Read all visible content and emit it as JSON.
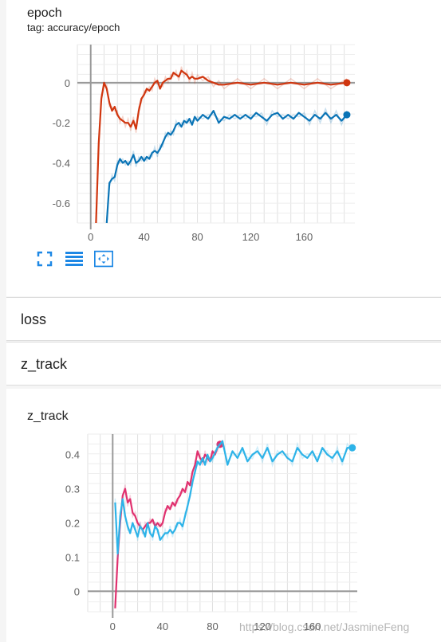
{
  "epoch_card": {
    "title": "epoch",
    "tag": "tag: accuracy/epoch",
    "tools": [
      "fit-domain-icon",
      "toggle-log-icon",
      "fit-to-data-icon"
    ]
  },
  "sections": {
    "loss": "loss",
    "z_track": "z_track"
  },
  "z_card": {
    "title": "z_track"
  },
  "watermark": "https://blog.csdn.net/JasmineFeng",
  "colors": {
    "red": "#d0360f",
    "red_light": "#f7b3a3",
    "blue": "#0a74b6",
    "blue_light": "#a9dcf2",
    "pink": "#e0316f",
    "cyan": "#2db3e8"
  },
  "chart_data": [
    {
      "type": "line",
      "title": "epoch",
      "subtitle": "tag: accuracy/epoch",
      "x_ticks": [
        0,
        40,
        80,
        120,
        160
      ],
      "y_ticks": [
        "0",
        "-0.2",
        "-0.4",
        "-0.6"
      ],
      "xlim": [
        -10,
        198
      ],
      "ylim": [
        -0.7,
        0.19
      ],
      "series": [
        {
          "color": "#d0360f",
          "x": [
            4,
            6,
            8,
            10,
            12,
            14,
            16,
            18,
            20,
            22,
            24,
            26,
            28,
            30,
            32,
            34,
            36,
            38,
            40,
            42,
            44,
            46,
            48,
            50,
            52,
            54,
            56,
            58,
            60,
            62,
            64,
            66,
            68,
            70,
            72,
            74,
            76,
            78,
            80,
            84,
            88,
            92,
            96,
            100,
            110,
            120,
            130,
            140,
            150,
            160,
            170,
            180,
            192
          ],
          "y": [
            -0.7,
            -0.3,
            -0.08,
            0.0,
            -0.03,
            -0.1,
            -0.14,
            -0.12,
            -0.16,
            -0.18,
            -0.19,
            -0.2,
            -0.2,
            -0.22,
            -0.19,
            -0.23,
            -0.14,
            -0.08,
            -0.06,
            -0.03,
            -0.04,
            -0.02,
            0.0,
            0.01,
            -0.03,
            0.0,
            0.01,
            0.02,
            0.02,
            0.05,
            0.04,
            0.03,
            0.06,
            0.05,
            0.04,
            0.02,
            0.03,
            0.02,
            0.02,
            0.03,
            0.01,
            0.0,
            -0.01,
            -0.01,
            0.0,
            -0.01,
            0.0,
            -0.01,
            0.0,
            -0.01,
            0.0,
            -0.01,
            0.0
          ]
        },
        {
          "color": "#0a74b6",
          "x": [
            12,
            14,
            16,
            18,
            20,
            22,
            24,
            26,
            28,
            30,
            32,
            34,
            36,
            38,
            40,
            42,
            44,
            46,
            48,
            50,
            52,
            54,
            56,
            58,
            60,
            62,
            64,
            66,
            68,
            70,
            72,
            74,
            76,
            78,
            80,
            84,
            88,
            92,
            96,
            100,
            104,
            108,
            112,
            116,
            120,
            124,
            128,
            132,
            136,
            140,
            144,
            148,
            152,
            156,
            160,
            164,
            168,
            172,
            176,
            180,
            184,
            188,
            192
          ],
          "y": [
            -0.7,
            -0.5,
            -0.48,
            -0.47,
            -0.41,
            -0.38,
            -0.4,
            -0.39,
            -0.41,
            -0.39,
            -0.36,
            -0.4,
            -0.39,
            -0.37,
            -0.39,
            -0.37,
            -0.38,
            -0.35,
            -0.34,
            -0.35,
            -0.33,
            -0.3,
            -0.27,
            -0.25,
            -0.26,
            -0.24,
            -0.21,
            -0.2,
            -0.22,
            -0.19,
            -0.2,
            -0.18,
            -0.21,
            -0.17,
            -0.19,
            -0.16,
            -0.18,
            -0.14,
            -0.2,
            -0.17,
            -0.18,
            -0.16,
            -0.18,
            -0.16,
            -0.18,
            -0.15,
            -0.17,
            -0.19,
            -0.16,
            -0.15,
            -0.18,
            -0.16,
            -0.18,
            -0.15,
            -0.17,
            -0.19,
            -0.16,
            -0.18,
            -0.15,
            -0.18,
            -0.16,
            -0.19,
            -0.16
          ]
        }
      ]
    },
    {
      "type": "line",
      "title": "z_track",
      "x_ticks": [
        0,
        40,
        80,
        120,
        160
      ],
      "y_ticks": [
        "0",
        "0.1",
        "0.2",
        "0.3",
        "0.4"
      ],
      "xlim": [
        -20,
        196
      ],
      "ylim": [
        -0.06,
        0.46
      ],
      "series": [
        {
          "color": "#e0316f",
          "x": [
            2,
            4,
            6,
            8,
            10,
            12,
            14,
            16,
            18,
            20,
            22,
            24,
            26,
            28,
            30,
            32,
            34,
            36,
            38,
            40,
            42,
            44,
            46,
            48,
            50,
            52,
            54,
            56,
            58,
            60,
            62,
            64,
            66,
            68,
            70,
            72,
            74,
            76,
            78,
            80,
            82,
            84,
            86
          ],
          "y": [
            -0.05,
            0.1,
            0.2,
            0.28,
            0.3,
            0.26,
            0.27,
            0.23,
            0.22,
            0.2,
            0.19,
            0.18,
            0.19,
            0.2,
            0.2,
            0.21,
            0.19,
            0.2,
            0.19,
            0.2,
            0.23,
            0.25,
            0.24,
            0.26,
            0.25,
            0.27,
            0.28,
            0.3,
            0.29,
            0.32,
            0.31,
            0.35,
            0.37,
            0.41,
            0.39,
            0.38,
            0.4,
            0.39,
            0.38,
            0.41,
            0.4,
            0.42,
            0.43
          ]
        },
        {
          "color": "#2db3e8",
          "x": [
            2,
            4,
            6,
            8,
            10,
            12,
            14,
            16,
            18,
            20,
            22,
            24,
            26,
            28,
            30,
            32,
            34,
            36,
            38,
            40,
            42,
            44,
            46,
            48,
            50,
            52,
            54,
            56,
            58,
            60,
            62,
            64,
            66,
            68,
            70,
            72,
            74,
            76,
            78,
            80,
            84,
            88,
            92,
            96,
            100,
            104,
            108,
            112,
            116,
            120,
            124,
            128,
            132,
            136,
            140,
            144,
            148,
            152,
            156,
            160,
            164,
            168,
            172,
            176,
            180,
            184,
            188,
            192
          ],
          "y": [
            0.26,
            0.11,
            0.22,
            0.27,
            0.22,
            0.19,
            0.17,
            0.2,
            0.18,
            0.16,
            0.19,
            0.18,
            0.16,
            0.2,
            0.17,
            0.16,
            0.19,
            0.18,
            0.15,
            0.16,
            0.17,
            0.17,
            0.18,
            0.17,
            0.18,
            0.2,
            0.2,
            0.19,
            0.22,
            0.25,
            0.28,
            0.32,
            0.35,
            0.38,
            0.37,
            0.39,
            0.37,
            0.4,
            0.38,
            0.39,
            0.42,
            0.44,
            0.37,
            0.41,
            0.39,
            0.42,
            0.38,
            0.4,
            0.41,
            0.39,
            0.42,
            0.38,
            0.4,
            0.41,
            0.39,
            0.38,
            0.42,
            0.4,
            0.39,
            0.41,
            0.38,
            0.42,
            0.4,
            0.39,
            0.41,
            0.38,
            0.42,
            0.42
          ]
        }
      ]
    }
  ]
}
